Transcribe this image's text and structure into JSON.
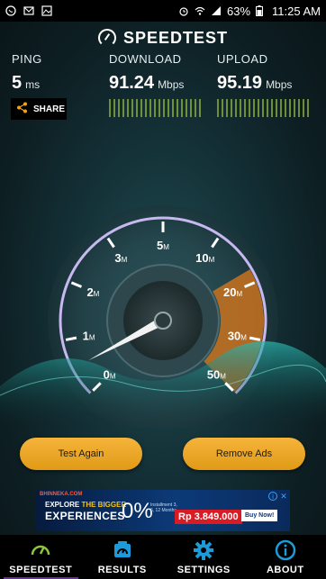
{
  "status_bar": {
    "battery": "63%",
    "time": "11:25 AM"
  },
  "header": {
    "title": "SPEEDTEST"
  },
  "metrics": {
    "ping": {
      "label": "PING",
      "value": "5",
      "unit": "ms"
    },
    "download": {
      "label": "DOWNLOAD",
      "value": "91.24",
      "unit": "Mbps"
    },
    "upload": {
      "label": "UPLOAD",
      "value": "95.19",
      "unit": "Mbps"
    }
  },
  "share_label": "SHARE",
  "gauge": {
    "ticks": [
      "0",
      "1",
      "2",
      "3",
      "5",
      "10",
      "20",
      "30",
      "50"
    ],
    "tick_unit": "M",
    "needle_value_mbps": 0.5,
    "accent_color": "#f08a1e",
    "ring_color": "#b9a7e8"
  },
  "buttons": {
    "test_again": "Test Again",
    "remove_ads": "Remove Ads"
  },
  "ad": {
    "brand": "BHINNEKA.COM",
    "line1_a": "EXPLORE ",
    "line1_b": "THE BIGGER",
    "line2": "EXPERIENCES",
    "percent": "0%",
    "installment": "Installment 3, 6, 12 Months",
    "price": "Rp 3.849.000",
    "buy": "Buy Now!"
  },
  "tabs": [
    {
      "label": "SPEEDTEST",
      "icon": "gauge-icon",
      "active": true
    },
    {
      "label": "RESULTS",
      "icon": "results-icon",
      "active": false
    },
    {
      "label": "SETTINGS",
      "icon": "gear-icon",
      "active": false
    },
    {
      "label": "ABOUT",
      "icon": "info-icon",
      "active": false
    }
  ]
}
